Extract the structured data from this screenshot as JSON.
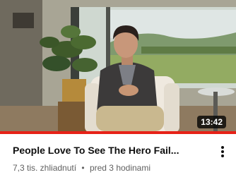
{
  "video": {
    "title": "People Love To See The Hero Fail...",
    "views": "7,3 tis. zhliadnutí",
    "separator": "•",
    "age": "pred 3 hodinami",
    "duration": "13:42",
    "watched_fraction": 1.0
  },
  "colors": {
    "progress": "#e62117",
    "title": "#0f0f0f",
    "meta": "#606060"
  },
  "icons": {
    "more": "more-vert-icon"
  }
}
